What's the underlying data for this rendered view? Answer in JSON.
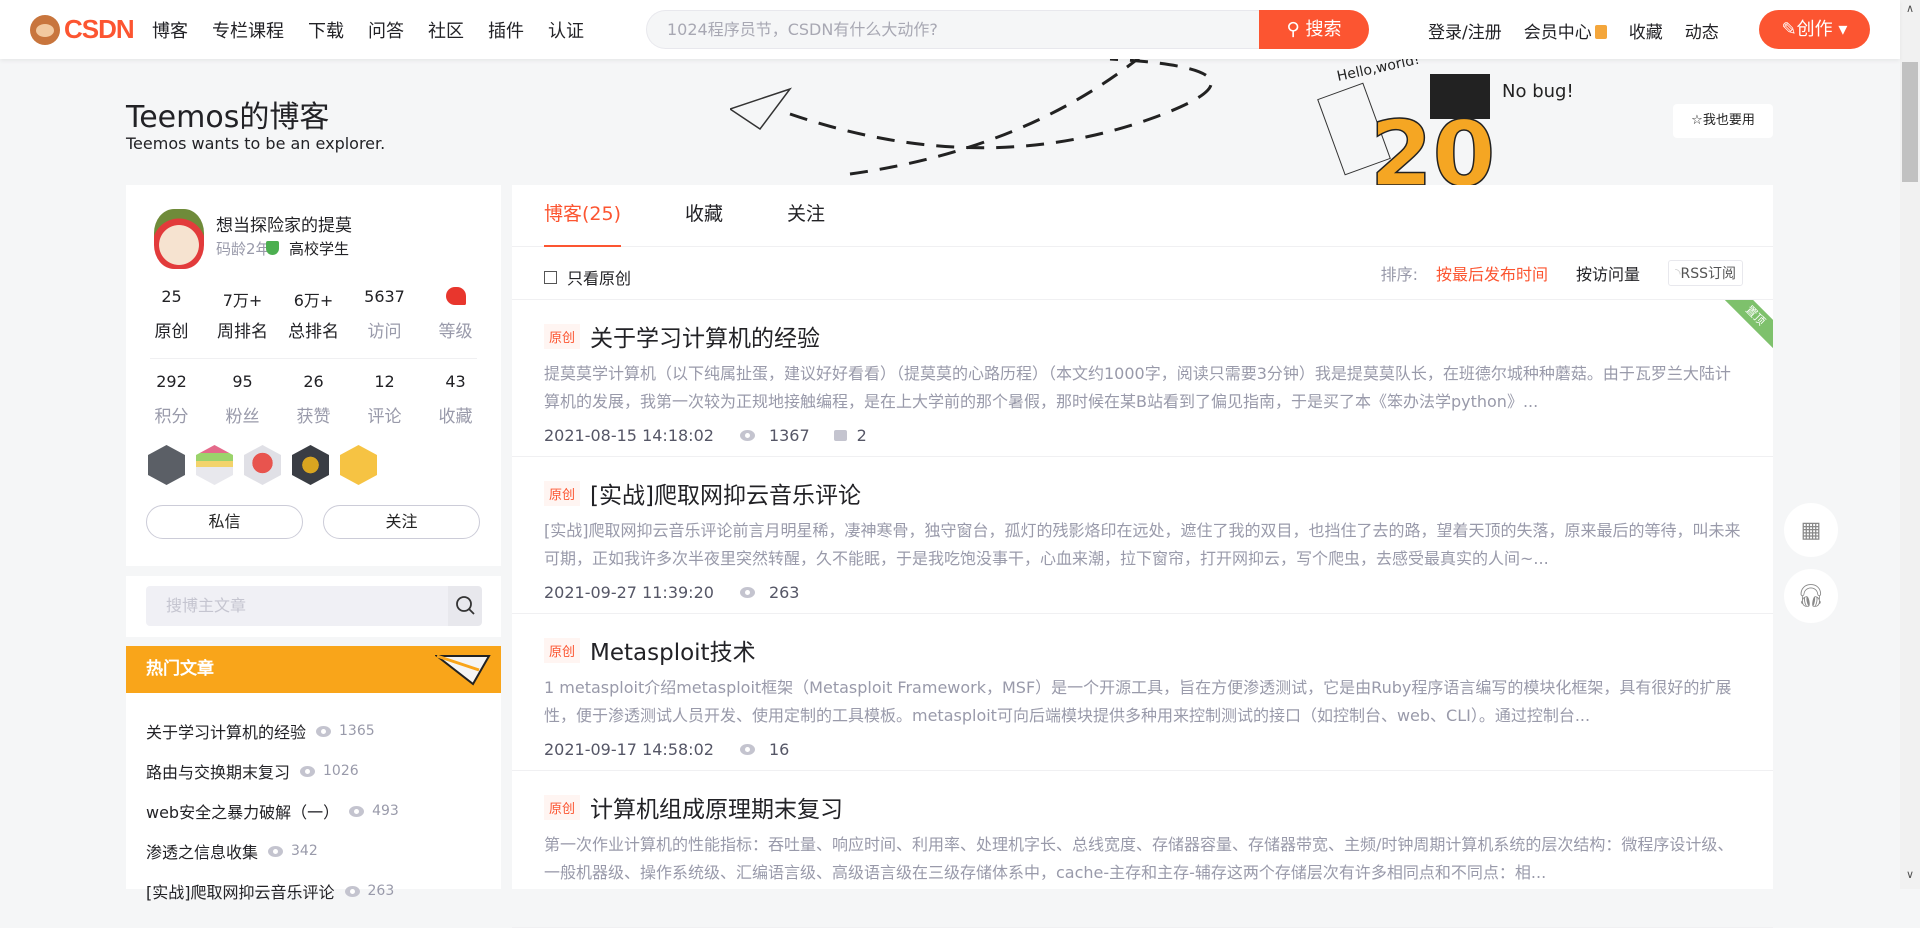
{
  "header": {
    "logo": "CSDN",
    "nav": [
      "博客",
      "专栏课程",
      "下载",
      "问答",
      "社区",
      "插件",
      "认证"
    ],
    "search_placeholder": "1024程序员节，CSDN有什么大动作?",
    "search_button": "搜索",
    "right_nav": {
      "login": "登录/注册",
      "vip": "会员中心",
      "favorites": "收藏",
      "dynamic": "动态"
    },
    "create_button": "创作",
    "accent": "#fc5531"
  },
  "blog": {
    "title": "Teemos的博客",
    "subtitle": "Teemos wants to be an explorer.",
    "use_button": "我也要用",
    "banner_text": [
      "Hello,world!",
      "No bug!",
      "20"
    ]
  },
  "profile": {
    "name": "想当探险家的提莫",
    "code_age": "码龄2年",
    "identity": "高校学生",
    "stats_row1": [
      {
        "n": "25",
        "l": "原创"
      },
      {
        "n": "7万+",
        "l": "周排名"
      },
      {
        "n": "6万+",
        "l": "总排名"
      },
      {
        "n": "5637",
        "l": "访问"
      },
      {
        "n": "",
        "l": "等级"
      }
    ],
    "stats_row2": [
      {
        "n": "292",
        "l": "积分"
      },
      {
        "n": "95",
        "l": "粉丝"
      },
      {
        "n": "26",
        "l": "获赞"
      },
      {
        "n": "12",
        "l": "评论"
      },
      {
        "n": "43",
        "l": "收藏"
      }
    ],
    "badges": [
      "github-badge",
      "10-year-badge",
      "monkey-badge",
      "persistence-badge",
      "pen-badge"
    ],
    "message_button": "私信",
    "follow_button": "关注"
  },
  "blog_search": {
    "placeholder": "搜博主文章"
  },
  "hot": {
    "title": "热门文章",
    "color": "#f9a51a",
    "items": [
      {
        "title": "关于学习计算机的经验",
        "views": "1365"
      },
      {
        "title": "路由与交换期末复习",
        "views": "1026"
      },
      {
        "title": "web安全之暴力破解（一）",
        "views": "493"
      },
      {
        "title": "渗透之信息收集",
        "views": "342"
      },
      {
        "title": "[实战]爬取网抑云音乐评论",
        "views": "263"
      }
    ]
  },
  "main": {
    "tabs": [
      "博客(25)",
      "收藏",
      "关注"
    ],
    "only_original": "只看原创",
    "sort_label": "排序:",
    "sort_latest": "按最后发布时间",
    "sort_views": "按访问量",
    "rss": "RSS订阅",
    "original_tag": "原创",
    "pinned_tag": "置顶",
    "articles": [
      {
        "title": "关于学习计算机的经验",
        "summary": "提莫莫学计算机（以下纯属扯蛋，建议好好看看）（提莫莫的心路历程）（本文约1000字，阅读只需要3分钟）我是提莫莫队长，在班德尔城种种蘑菇。由于瓦罗兰大陆计算机的发展，我第一次较为正规地接触编程，是在上大学前的那个暑假，那时候在某B站看到了偏见指南，于是买了本《笨办法学python》...",
        "date": "2021-08-15 14:18:02",
        "views": "1367",
        "comments": "2"
      },
      {
        "title": "[实战]爬取网抑云音乐评论",
        "summary": "[实战]爬取网抑云音乐评论前言月明星稀，凄神寒骨，独守窗台，孤灯的残影烙印在远处，遮住了我的双目，也挡住了去的路，望着天顶的失落，原来最后的等待，叫未来可期，正如我许多次半夜里突然转醒，久不能眠，于是我吃饱没事干，心血来潮，拉下窗帘，打开网抑云，写个爬虫，去感受最真实的人间~...",
        "date": "2021-09-27 11:39:20",
        "views": "263"
      },
      {
        "title": "Metasploit技术",
        "summary": "1 metasploit介绍metasploit框架（Metasploit Framework，MSF）是一个开源工具，旨在方便渗透测试，它是由Ruby程序语言编写的模块化框架，具有很好的扩展性，便于渗透测试人员开发、使用定制的工具模板。metasploit可向后端模块提供多种用来控制测试的接口（如控制台、web、CLI）。通过控制台...",
        "date": "2021-09-17 14:58:02",
        "views": "16"
      },
      {
        "title": "计算机组成原理期末复习",
        "summary": "第一次作业计算机的性能指标：吞吐量、响应时间、利用率、处理机字长、总线宽度、存储器容量、存储器带宽、主频/时钟周期计算机系统的层次结构：微程序设计级、一般机器级、操作系统级、汇编语言级、高级语言级在三级存储体系中，cache-主存和主存-辅存这两个存储层次有许多相同点和不同点：相...",
        "date": "",
        "views": ""
      }
    ]
  }
}
